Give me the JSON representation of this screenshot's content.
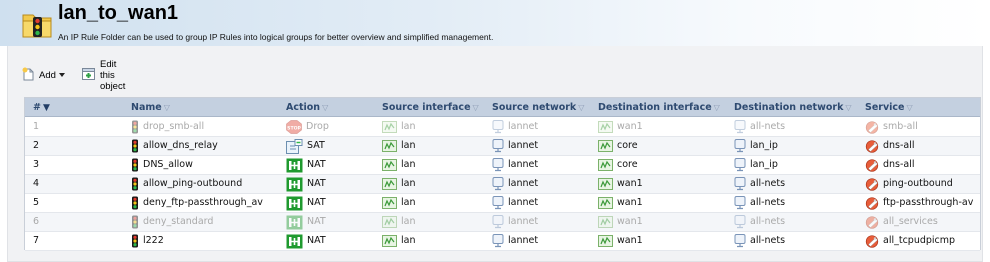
{
  "header": {
    "title": "lan_to_wan1",
    "description": "An IP Rule Folder can be used to group IP Rules into logical groups for better overview and simplified management."
  },
  "toolbar": {
    "add_label": "Add",
    "edit_label": "Edit this object"
  },
  "table": {
    "columns": [
      {
        "label": "#",
        "sort_indicator": "▼"
      },
      {
        "label": "Name",
        "sort_indicator": "▽"
      },
      {
        "label": "Action",
        "sort_indicator": "▽"
      },
      {
        "label": "Source interface",
        "sort_indicator": "▽"
      },
      {
        "label": "Source network",
        "sort_indicator": "▽"
      },
      {
        "label": "Destination interface",
        "sort_indicator": "▽"
      },
      {
        "label": "Destination network",
        "sort_indicator": "▽"
      },
      {
        "label": "Service",
        "sort_indicator": "▽"
      }
    ],
    "rows": [
      {
        "num": "1",
        "name": "drop_smb-all",
        "action": "Drop",
        "action_icon": "stop-icon",
        "src_if": "lan",
        "src_net": "lannet",
        "dst_if": "wan1",
        "dst_net": "all-nets",
        "service": "smb-all",
        "disabled": true
      },
      {
        "num": "2",
        "name": "allow_dns_relay",
        "action": "SAT",
        "action_icon": "sat-icon",
        "src_if": "lan",
        "src_net": "lannet",
        "dst_if": "core",
        "dst_net": "lan_ip",
        "service": "dns-all",
        "disabled": false
      },
      {
        "num": "3",
        "name": "DNS_allow",
        "action": "NAT",
        "action_icon": "nat-icon",
        "src_if": "lan",
        "src_net": "lannet",
        "dst_if": "core",
        "dst_net": "lan_ip",
        "service": "dns-all",
        "disabled": false
      },
      {
        "num": "4",
        "name": "allow_ping-outbound",
        "action": "NAT",
        "action_icon": "nat-icon",
        "src_if": "lan",
        "src_net": "lannet",
        "dst_if": "wan1",
        "dst_net": "all-nets",
        "service": "ping-outbound",
        "disabled": false
      },
      {
        "num": "5",
        "name": "deny_ftp-passthrough_av",
        "action": "NAT",
        "action_icon": "nat-icon",
        "src_if": "lan",
        "src_net": "lannet",
        "dst_if": "wan1",
        "dst_net": "all-nets",
        "service": "ftp-passthrough-av",
        "disabled": false
      },
      {
        "num": "6",
        "name": "deny_standard",
        "action": "NAT",
        "action_icon": "nat-icon",
        "src_if": "lan",
        "src_net": "lannet",
        "dst_if": "wan1",
        "dst_net": "all-nets",
        "service": "all_services",
        "disabled": true
      },
      {
        "num": "7",
        "name": "l222",
        "action": "NAT",
        "action_icon": "nat-icon",
        "src_if": "lan",
        "src_net": "lannet",
        "dst_if": "wan1",
        "dst_net": "all-nets",
        "service": "all_tcpudpicmp",
        "disabled": false
      }
    ]
  },
  "colors": {
    "header_gradient_start": "#cfe0ef",
    "table_header_bg": "#c4d0e0",
    "table_header_text": "#2e4a70",
    "disabled_text": "#a9a9a9",
    "nat_green": "#1f9a2f",
    "drop_red": "#e04a3a"
  }
}
